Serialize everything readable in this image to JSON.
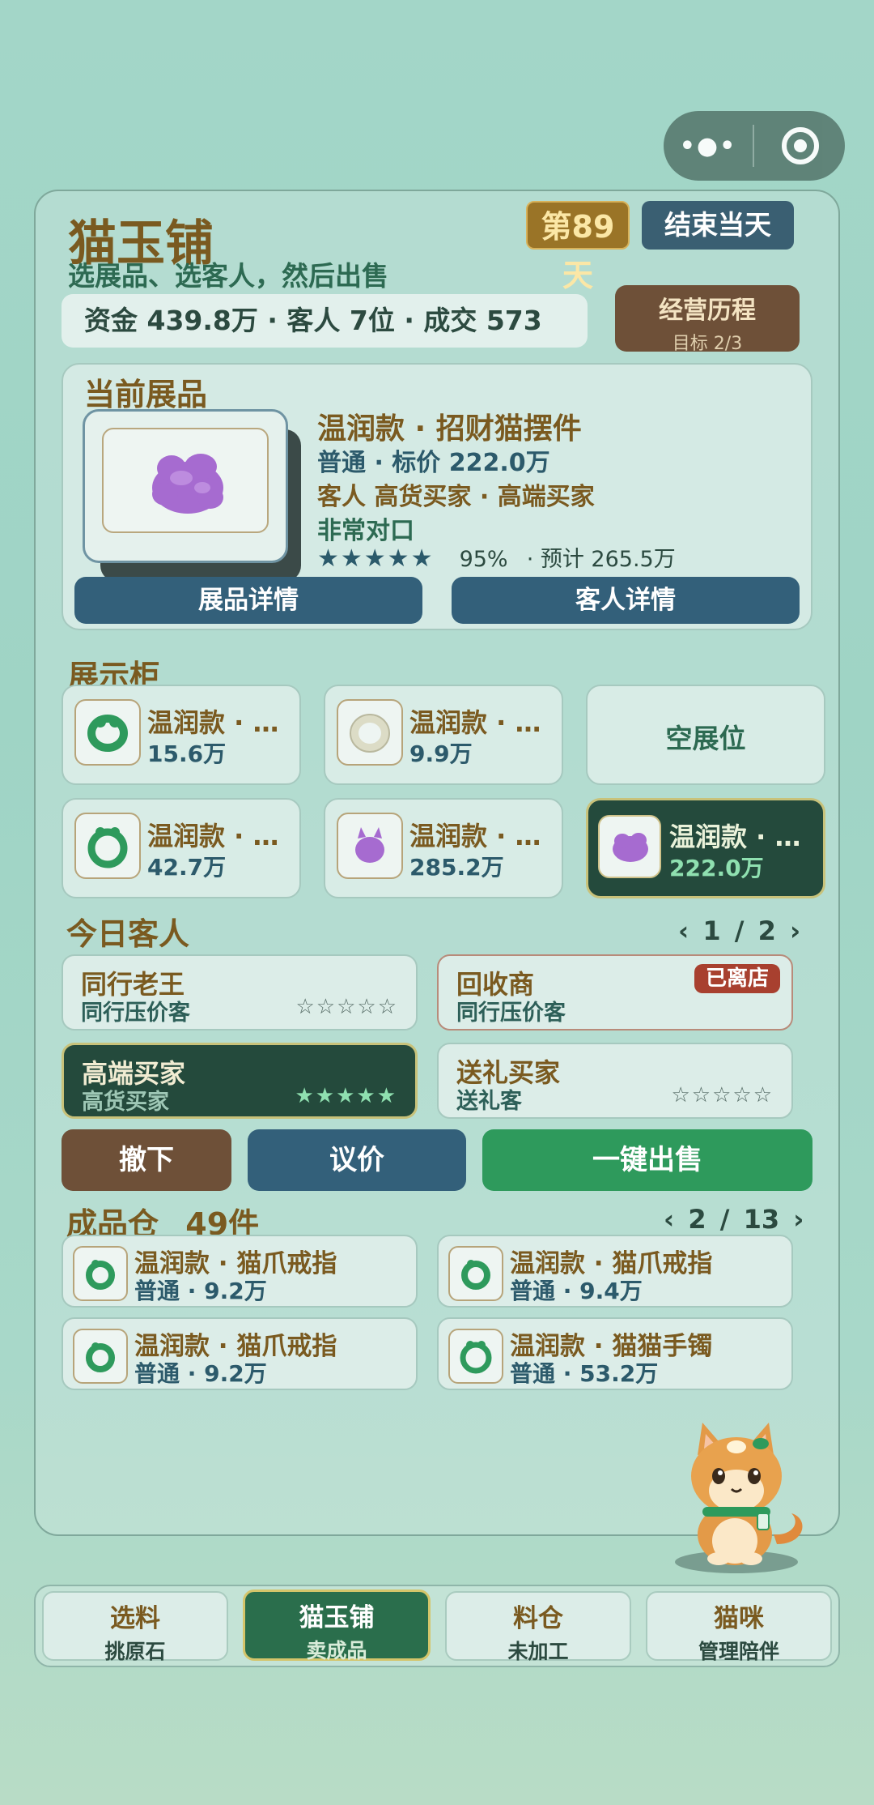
{
  "header": {
    "title": "猫玉铺",
    "subtitle": "选展品、选客人，然后出售",
    "day": "第89天",
    "end_day": "结束当天",
    "stats": "资金 439.8万 · 客人 7位 · 成交 573",
    "history_title": "经营历程",
    "history_goal": "目标 2/3"
  },
  "current": {
    "label": "当前展品",
    "name": "温润款 · 招财猫摆件",
    "grade_price": "普通 · 标价 222.0万",
    "customer": "客人 高货买家 · 高端买家",
    "match": "非常对口",
    "stars": "★★★★★",
    "rate": "95%",
    "forecast": "· 预计 265.5万",
    "detail_btn": "展品详情",
    "customer_btn": "客人详情"
  },
  "showcase": {
    "label": "展示柜",
    "slots": [
      {
        "name": "温润款 · 猫...",
        "price": "15.6万"
      },
      {
        "name": "温润款 · 猫...",
        "price": "9.9万"
      },
      {
        "name": "空展位"
      },
      {
        "name": "温润款 · 猫...",
        "price": "42.7万"
      },
      {
        "name": "温润款 · 招...",
        "price": "285.2万"
      },
      {
        "name": "温润款 · 招...",
        "price": "222.0万"
      }
    ]
  },
  "customers": {
    "label": "今日客人",
    "pager": "‹ 1 / 2 ›",
    "items": [
      {
        "name": "同行老王",
        "type": "同行压价客",
        "stars": "☆☆☆☆☆"
      },
      {
        "name": "回收商",
        "type": "同行压价客",
        "badge": "已离店"
      },
      {
        "name": "高端买家",
        "type": "高货买家",
        "stars": "★★★★★"
      },
      {
        "name": "送礼买家",
        "type": "送礼客",
        "stars": "☆☆☆☆☆"
      }
    ]
  },
  "actions": {
    "remove": "撤下",
    "negotiate": "议价",
    "sell": "一键出售"
  },
  "inventory": {
    "label": "成品仓",
    "count": "49件",
    "pager": "‹ 2 / 13 ›",
    "items": [
      {
        "name": "温润款 · 猫爪戒指",
        "info": "普通 · 9.2万"
      },
      {
        "name": "温润款 · 猫爪戒指",
        "info": "普通 · 9.4万"
      },
      {
        "name": "温润款 · 猫爪戒指",
        "info": "普通 · 9.2万"
      },
      {
        "name": "温润款 · 猫猫手镯",
        "info": "普通 · 53.2万"
      }
    ]
  },
  "tabs": [
    {
      "title": "选料",
      "sub": "挑原石"
    },
    {
      "title": "猫玉铺",
      "sub": "卖成品"
    },
    {
      "title": "料仓",
      "sub": "未加工"
    },
    {
      "title": "猫咪",
      "sub": "管理陪伴"
    }
  ],
  "colors": {
    "jade_green": "#2e9a5c",
    "purple_item": "#a66bd0",
    "brown": "#7a5a20"
  },
  "icons": {
    "capsule_more": "more-dots-icon",
    "capsule_close": "target-icon"
  }
}
